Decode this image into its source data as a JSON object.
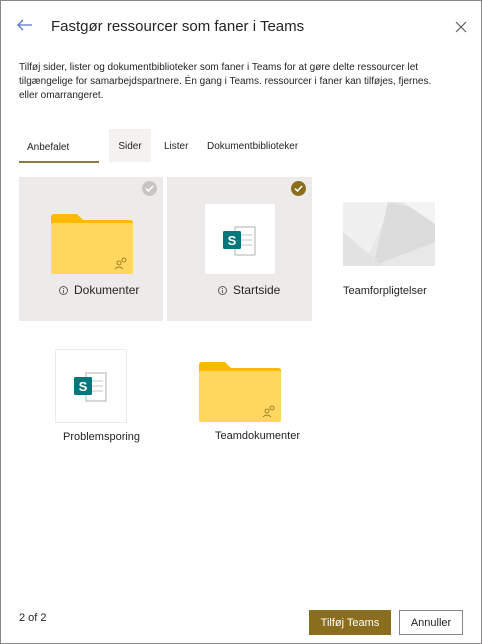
{
  "header": {
    "title": "Fastgør ressourcer som faner i Teams",
    "back_icon": "arrow-left-icon",
    "close_icon": "close-icon"
  },
  "description": {
    "line1": "Tilføj sider, lister og dokumentbiblioteker som faner i Teams for at gøre delte ressourcer let",
    "line2": "tilgængelige for samarbejdspartnere. Én gang i Teams. ressourcer i faner kan tilføjes, fjernes.",
    "line3": "eller omarrangeret."
  },
  "tabs": [
    {
      "label": "Anbefalet",
      "active": true
    },
    {
      "label": "Sider",
      "active": false
    },
    {
      "label": "Lister",
      "active": false
    },
    {
      "label": "Dokumentbiblioteker",
      "active": false
    }
  ],
  "tiles": [
    {
      "label": "Dokumenter",
      "kind": "folder",
      "selected": false,
      "has_info": true
    },
    {
      "label": "Startside",
      "kind": "page",
      "selected": true,
      "has_info": true
    },
    {
      "label": "Teamforpligtelser",
      "kind": "image",
      "selected": false,
      "has_info": false
    },
    {
      "label": "Problemsporing",
      "kind": "page",
      "selected": false,
      "has_info": false
    },
    {
      "label": "Teamdokumenter",
      "kind": "folder",
      "selected": false,
      "has_info": false
    }
  ],
  "footer": {
    "page_count": "2 of 2",
    "primary_label": "Tilføj Teams",
    "secondary_label": "Annuller"
  },
  "colors": {
    "accent": "#8a6d1d",
    "folder_body": "#ffd75e",
    "folder_tab": "#ffb900",
    "sharepoint_green": "#03787c"
  }
}
